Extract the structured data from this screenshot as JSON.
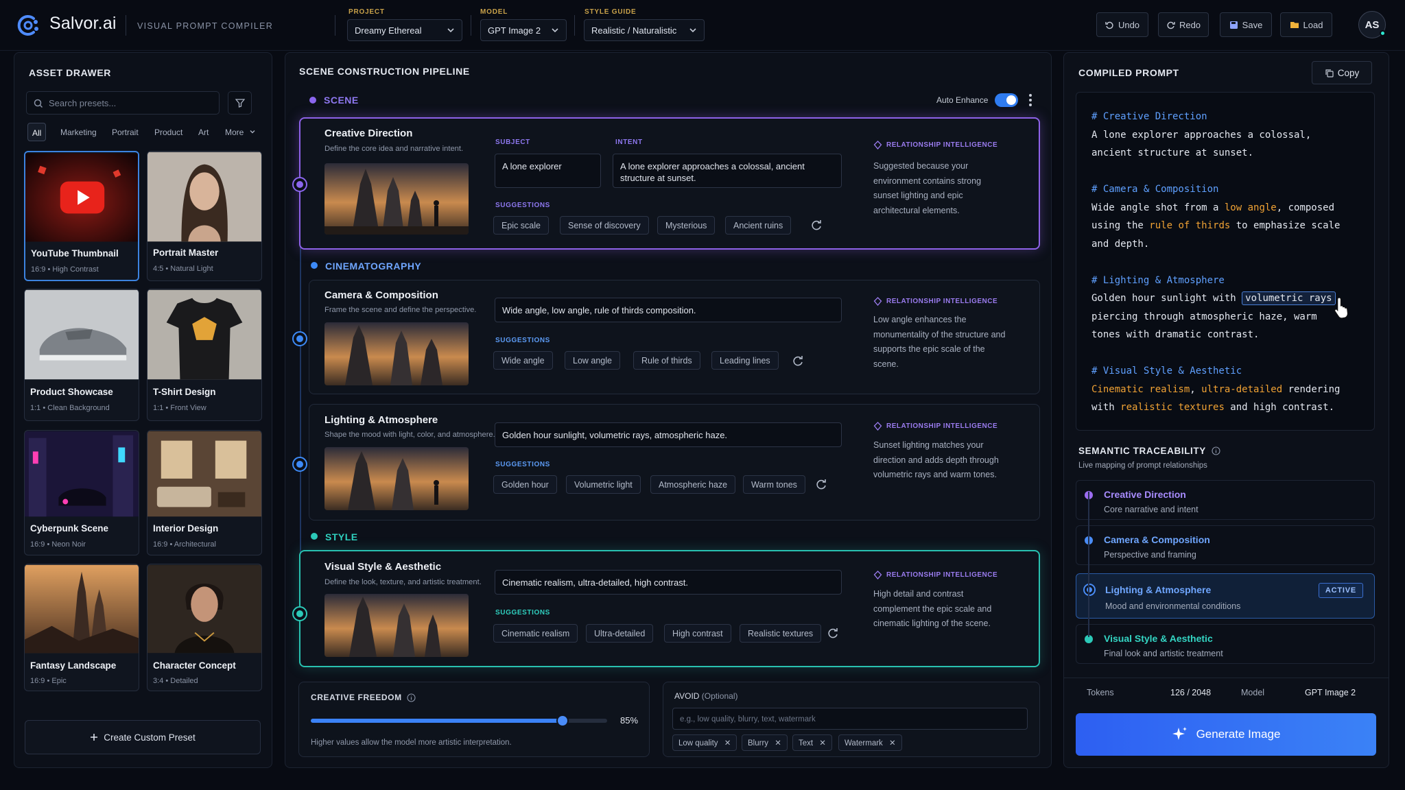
{
  "app": {
    "name": "Salvor.ai",
    "tagline": "VISUAL PROMPT COMPILER",
    "user_initials": "AS"
  },
  "toolbar": {
    "project": {
      "label": "PROJECT",
      "value": "Dreamy Ethereal"
    },
    "model": {
      "label": "MODEL",
      "value": "GPT Image 2"
    },
    "style_guide": {
      "label": "STYLE GUIDE",
      "value": "Realistic / Naturalistic"
    },
    "undo": "Undo",
    "redo": "Redo",
    "save": "Save",
    "load": "Load"
  },
  "asset_drawer": {
    "title": "ASSET DRAWER",
    "search_placeholder": "Search presets...",
    "categories": [
      "All",
      "Marketing",
      "Portrait",
      "Product",
      "Art",
      "More"
    ],
    "presets": [
      {
        "name": "YouTube Thumbnail",
        "ratio": "16:9",
        "tag": "High Contrast"
      },
      {
        "name": "Portrait Master",
        "ratio": "4:5",
        "tag": "Natural Light"
      },
      {
        "name": "Product Showcase",
        "ratio": "1:1",
        "tag": "Clean Background"
      },
      {
        "name": "T-Shirt Design",
        "ratio": "1:1",
        "tag": "Front View"
      },
      {
        "name": "Cyberpunk Scene",
        "ratio": "16:9",
        "tag": "Neon Noir"
      },
      {
        "name": "Interior Design",
        "ratio": "16:9",
        "tag": "Architectural"
      },
      {
        "name": "Fantasy Landscape",
        "ratio": "16:9",
        "tag": "Epic"
      },
      {
        "name": "Character Concept",
        "ratio": "3:4",
        "tag": "Detailed"
      }
    ],
    "create_button": "Create Custom Preset",
    "dot": "•"
  },
  "pipeline": {
    "title": "SCENE CONSTRUCTION PIPELINE",
    "auto_enhance": "Auto Enhance",
    "auto_enhance_on": true,
    "sections": {
      "scene": "SCENE",
      "cinematography": "CINEMATOGRAPHY",
      "style": "STYLE"
    },
    "suggestions_label": "SUGGESTIONS",
    "rel_label": "RELATIONSHIP INTELLIGENCE",
    "creative": {
      "title": "Creative Direction",
      "desc": "Define the core idea and narrative intent.",
      "subject_label": "SUBJECT",
      "subject": "A lone explorer",
      "intent_label": "INTENT",
      "intent": "A lone explorer approaches a colossal, ancient structure at sunset.",
      "suggestions": [
        "Epic scale",
        "Sense of discovery",
        "Mysterious",
        "Ancient ruins"
      ],
      "rel": "Suggested because your environment contains strong sunset lighting and epic architectural elements."
    },
    "camera": {
      "title": "Camera & Composition",
      "desc": "Frame the scene and define the perspective.",
      "value": "Wide angle, low angle, rule of thirds composition.",
      "suggestions": [
        "Wide angle",
        "Low angle",
        "Rule of thirds",
        "Leading lines"
      ],
      "rel": "Low angle enhances the monumentality of the structure and supports the epic scale of the scene."
    },
    "lighting": {
      "title": "Lighting & Atmosphere",
      "desc": "Shape the mood with light, color, and atmosphere.",
      "value": "Golden hour sunlight, volumetric rays, atmospheric haze.",
      "suggestions": [
        "Golden hour",
        "Volumetric light",
        "Atmospheric haze",
        "Warm tones"
      ],
      "rel": "Sunset lighting matches your direction and adds depth through volumetric rays and warm tones."
    },
    "style": {
      "title": "Visual Style & Aesthetic",
      "desc": "Define the look, texture, and artistic treatment.",
      "value": "Cinematic realism, ultra-detailed, high contrast.",
      "suggestions": [
        "Cinematic realism",
        "Ultra-detailed",
        "High contrast",
        "Realistic textures"
      ],
      "rel": "High detail and contrast complement the epic scale and cinematic lighting of the scene."
    },
    "freedom": {
      "label": "CREATIVE FREEDOM",
      "value_text": "85%",
      "value": 0.85,
      "hint": "Higher values allow the model more artistic interpretation."
    },
    "avoid": {
      "label": "AVOID",
      "optional": "(Optional)",
      "placeholder": "e.g., low quality, blurry, text, watermark",
      "tags": [
        "Low quality",
        "Blurry",
        "Text",
        "Watermark"
      ]
    }
  },
  "compiled": {
    "title": "COMPILED PROMPT",
    "copy": "Copy",
    "c1": "# Creative Direction",
    "t1a": "A lone explorer approaches a colossal,",
    "t1b": "ancient structure at sunset.",
    "c2": "# Camera & Composition",
    "t2a_pre": "Wide angle shot from a ",
    "t2a_hl": "low angle",
    "t2a_post": ", composed",
    "t2b_pre": "using the ",
    "t2b_hl": "rule of thirds",
    "t2b_post": " to emphasize scale",
    "t2c": "and depth.",
    "c3": "# Lighting & Atmosphere",
    "t3a_pre": "Golden hour sunlight with ",
    "t3a_box": "volumetric rays",
    "t3b": "piercing through atmospheric haze, warm",
    "t3c": "tones with dramatic contrast.",
    "c4": "# Visual Style & Aesthetic",
    "t4a_hl1": "Cinematic realism",
    "t4a_mid": ", ",
    "t4a_hl2": "ultra-detailed",
    "t4a_post": " rendering",
    "t4b_pre": "with ",
    "t4b_hl": "realistic textures",
    "t4b_post": " and high contrast."
  },
  "traceability": {
    "title": "SEMANTIC TRACEABILITY",
    "subtitle": "Live mapping of prompt relationships",
    "items": [
      {
        "title": "Creative Direction",
        "sub": "Core narrative and intent",
        "color": "#9b6cf0"
      },
      {
        "title": "Camera & Composition",
        "sub": "Perspective and framing",
        "color": "#4a8cf5"
      },
      {
        "title": "Lighting & Atmosphere",
        "sub": "Mood and environmental conditions",
        "color": "#4a8cf5",
        "badge": "ACTIVE"
      },
      {
        "title": "Visual Style & Aesthetic",
        "sub": "Final look and artistic treatment",
        "color": "#2cc9b8"
      }
    ]
  },
  "footer": {
    "tokens_label": "Tokens",
    "tokens_value": "126 / 2048",
    "model_label": "Model",
    "model_value": "GPT Image 2",
    "generate": "Generate Image"
  }
}
